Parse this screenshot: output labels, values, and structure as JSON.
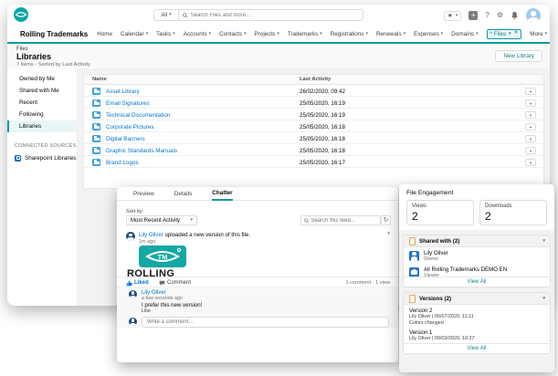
{
  "colors": {
    "brand_teal": "#0e9ba1",
    "logo_teal": "#14a8a4",
    "link_blue": "#0176d3",
    "folder_blue": "#3f9fdc",
    "view_all_teal": "#0e8a93",
    "panel_gray": "#f3f2f2"
  },
  "icons": {
    "caret_down": "▾",
    "close": "✕",
    "star": "★",
    "plus": "+",
    "help": "?",
    "gear": "⚙",
    "refresh": "↻",
    "pencil": "✎"
  },
  "top_bar": {
    "search_scope": "All",
    "search_placeholder": "Search Files and more..."
  },
  "nav": {
    "app_name": "Rolling Trademarks",
    "items": [
      "Home",
      "Calendar",
      "Tasks",
      "Accounts",
      "Contacts",
      "Projects",
      "Trademarks",
      "Registrations",
      "Renewals",
      "Expenses",
      "Domains"
    ],
    "active_tab": "* Files",
    "more_label": "More"
  },
  "page_header": {
    "eyebrow": "Files",
    "title": "Libraries",
    "meta": "7 items - Sorted by Last Activity",
    "new_library_button": "New Library"
  },
  "sidebar": {
    "items": [
      "Owned by Me",
      "Shared with Me",
      "Recent",
      "Following",
      "Libraries"
    ],
    "selected_item": "Libraries",
    "section_label": "CONNECTED SOURCES",
    "connected_source": "Sharepoint Libraries"
  },
  "files_table": {
    "columns": [
      "Name",
      "Last Activity"
    ],
    "rows": [
      {
        "name": "Asset Library",
        "last_activity": "26/02/2020, 09:42"
      },
      {
        "name": "Email Signatures",
        "last_activity": "25/05/2020, 16:19"
      },
      {
        "name": "Technical Documentation",
        "last_activity": "25/05/2020, 16:19"
      },
      {
        "name": "Corporate Pictures",
        "last_activity": "25/05/2020, 16:18"
      },
      {
        "name": "Digital Banners",
        "last_activity": "25/05/2020, 16:18"
      },
      {
        "name": "Graphic Standards Manuals",
        "last_activity": "25/05/2020, 16:18"
      },
      {
        "name": "Brand Logos",
        "last_activity": "25/05/2020, 16:17"
      }
    ]
  },
  "chatter_panel": {
    "tabs": [
      "Preview",
      "Details",
      "Chatter"
    ],
    "active_tab": "Chatter",
    "sort_label": "Sort by:",
    "sort_value": "Most Recent Activity",
    "feed_search_placeholder": "Search this feed...",
    "post": {
      "author": "Lily Oliver",
      "action_text": "uploaded a new version of this file.",
      "timestamp": "1m ago",
      "image": {
        "logo_text": "TM",
        "caption": "ROLLING"
      },
      "liked_label": "Liked",
      "comment_label": "Comment",
      "stats": "1 comment · 1 view",
      "comment": {
        "author": "Lily Oliver",
        "timestamp": "a few seconds ago",
        "text": "I prefer this new version!",
        "like_label": "Like"
      },
      "comment_placeholder": "Write a comment..."
    }
  },
  "engagement_panel": {
    "title": "File Engagement",
    "stats": [
      {
        "label": "Views",
        "value": "2"
      },
      {
        "label": "Downloads",
        "value": "2"
      }
    ],
    "shared_with": {
      "title": "Shared with (2)",
      "items": [
        {
          "name": "Lily Oliver",
          "role": "Owner"
        },
        {
          "name": "All Rolling Trademarks DEMO EN",
          "role": "Viewer"
        }
      ],
      "view_all": "View All"
    },
    "versions": {
      "title": "Versions (2)",
      "items": [
        {
          "name": "Version 2",
          "meta": "Lily Oliver | 06/07/2020, 11:11",
          "note": "Colors changed"
        },
        {
          "name": "Version 1",
          "meta": "Lily Oliver | 09/03/2020, 10:27",
          "note": ""
        }
      ],
      "view_all": "View All"
    }
  }
}
